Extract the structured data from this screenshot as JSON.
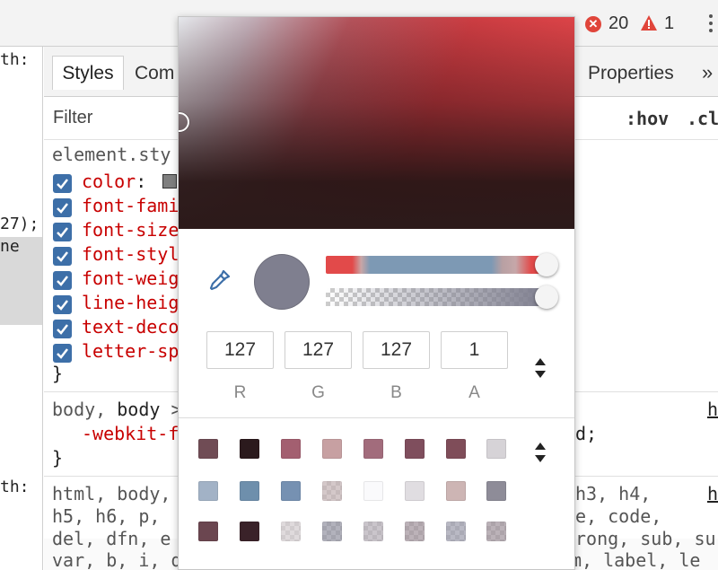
{
  "toolbar": {
    "error_count": "20",
    "warning_count": "1",
    "error_color": "#e0453a",
    "warning_color": "#e0453a"
  },
  "gutter": {
    "lines": [
      "th:",
      "27);",
      "ne",
      "th:"
    ]
  },
  "tabs": {
    "styles": "Styles",
    "computed": "Com",
    "properties": "Properties",
    "more": "»"
  },
  "filter": {
    "placeholder": "Filter",
    "hov": ":hov",
    "cls": ".cl"
  },
  "rules": {
    "element_selector": "element.sty",
    "props": [
      {
        "name": "color",
        "suffix": ":"
      },
      {
        "name": "font-fami",
        "suffix": ""
      },
      {
        "name": "font-size",
        "suffix": ""
      },
      {
        "name": "font-styl",
        "suffix": ""
      },
      {
        "name": "font-weig",
        "suffix": ""
      },
      {
        "name": "line-heig",
        "suffix": ""
      },
      {
        "name": "text-deco",
        "suffix": ""
      },
      {
        "name": "letter-sp",
        "suffix": ""
      }
    ],
    "close_brace": "}",
    "body_selector_a": "body, ",
    "body_selector_b": "body",
    "body_selector_c": " >",
    "webkit_prop": "-webkit-f",
    "body_tail": "d;",
    "body_close": "}",
    "html_line1": "html, body,",
    "html_line1_tail": "h3, h4,",
    "html_line2": "h5, h6, p,",
    "html_line2_tail": "e, code,",
    "html_line3": "del, dfn, e",
    "html_line3_tail": "rong, sub, su",
    "html_line4": "var, b, i, dt, dt, dd, ol, ul, li, fieldset, form, label, le",
    "src_link_1": "h",
    "src_link_2": "h",
    "swatch_color": "#7f7f7f"
  },
  "color_picker": {
    "current_color": "#7f7f8f",
    "rgba": [
      {
        "label": "R",
        "value": "127"
      },
      {
        "label": "G",
        "value": "127"
      },
      {
        "label": "B",
        "value": "127"
      },
      {
        "label": "A",
        "value": "1"
      }
    ],
    "hue_accent": "#dd4448",
    "swatches": [
      [
        "#704c55",
        "#2b1a1d",
        "#a35f70",
        "#c7a0a2",
        "#a26c7c",
        "#7f4e5d",
        "#7f4d59",
        "#d6d3d7"
      ],
      [
        "#a2b2c6",
        "#6e8fac",
        "#7691b2",
        "checker:#b8a3a5",
        "#fafafc",
        "#e0dde1",
        "#cdb5b4",
        "#8e8c98"
      ],
      [
        "#6b4650",
        "#3a2229",
        "checker:#c9c2c4",
        "checker:#7f7f8f",
        "checker:#a69ea8",
        "checker:#8f7f89",
        "checker:#8a8b9c",
        "checker:#8e7f88"
      ]
    ]
  }
}
